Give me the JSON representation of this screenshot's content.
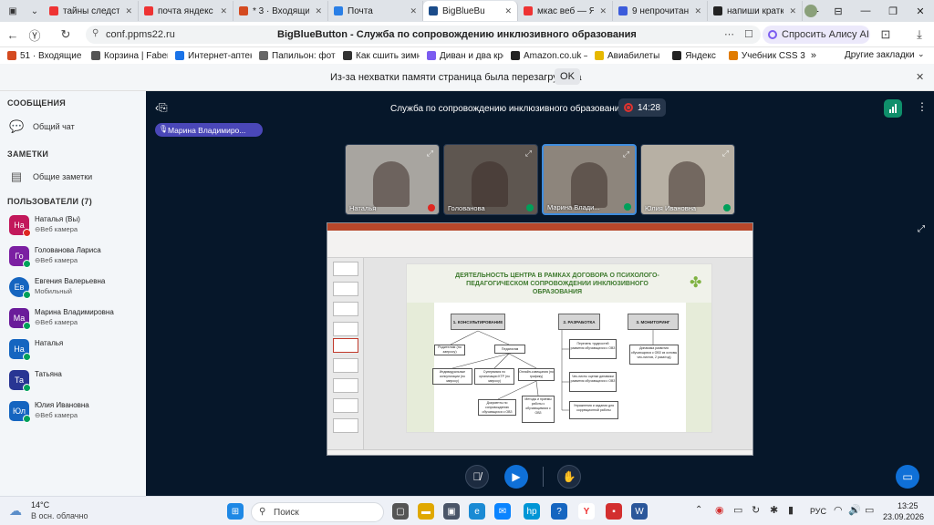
{
  "browser": {
    "tabs": [
      {
        "title": "тайны следстви",
        "color": "#e33"
      },
      {
        "title": "почта яндекс -",
        "color": "#e33"
      },
      {
        "title": "* 3 · Входящие",
        "color": "#d44a20"
      },
      {
        "title": "Почта",
        "color": "#2a7fe6"
      },
      {
        "title": "BigBlueBu",
        "color": "#1b4c8a",
        "active": true
      },
      {
        "title": "мкас веб — Янд",
        "color": "#e33"
      },
      {
        "title": "9 непрочитанн",
        "color": "#3b5bdb"
      },
      {
        "title": "напиши кратко",
        "color": "#222"
      }
    ],
    "url": "conf.ppms22.ru",
    "page_title": "BigBlueButton - Служба по сопровождению инклюзивного образования",
    "alice_label": "Спросить Алису AI",
    "bookmarks": [
      {
        "label": "51 · Входящие — Я",
        "color": "#d44a20"
      },
      {
        "label": "Корзина | Faberlic",
        "color": "#555"
      },
      {
        "label": "Интернет-аптека",
        "color": "#1a73e8"
      },
      {
        "label": "Папильон: фото, о",
        "color": "#666"
      },
      {
        "label": "Как сшить зимни",
        "color": "#333"
      },
      {
        "label": "Диван и два крес",
        "color": "#7b5cf0"
      },
      {
        "label": "Amazon.co.uk – O",
        "color": "#222"
      },
      {
        "label": "Авиабилеты",
        "color": "#e6b800"
      },
      {
        "label": "Яндекс",
        "color": "#222"
      },
      {
        "label": "Учебник CSS 3. C",
        "color": "#e07b00"
      }
    ],
    "other_bookmarks": "Другие закладки",
    "notification": "Из-за нехватки памяти страница была перезагружена",
    "notification_ok": "OK"
  },
  "sidebar": {
    "messages_title": "СООБЩЕНИЯ",
    "public_chat": "Общий чат",
    "notes_title": "ЗАМЕТКИ",
    "shared_notes": "Общие заметки",
    "users_title": "ПОЛЬЗОВАТЕЛИ (7)",
    "users": [
      {
        "initials": "На",
        "name": "Наталья (Вы)",
        "sub": "⊖Веб камера",
        "color": "#c2185b",
        "muted": true
      },
      {
        "initials": "Го",
        "name": "Голованова Лариса",
        "sub": "⊖Веб камера",
        "color": "#7b1fa2",
        "muted": false
      },
      {
        "initials": "Ев",
        "name": "Евгения Валерьевна",
        "sub": "Мобильный",
        "color": "#1565c0",
        "muted": false
      },
      {
        "initials": "Ма",
        "name": "Марина Владимировна",
        "sub": "⊖Веб камера",
        "color": "#6a1b9a",
        "muted": false
      },
      {
        "initials": "На",
        "name": "Наталья",
        "sub": "",
        "color": "#1565c0",
        "muted": false
      },
      {
        "initials": "Та",
        "name": "Татьяна",
        "sub": "",
        "color": "#283593",
        "muted": false
      },
      {
        "initials": "Юл",
        "name": "Юлия Ивановна",
        "sub": "⊖Веб камера",
        "color": "#1565c0",
        "muted": false
      }
    ]
  },
  "meeting": {
    "title": "Служба по сопровождению инклюзивного образования",
    "timer": "14:28",
    "talker": "Марина Владимиро...",
    "cameras": [
      {
        "name": "Наталья",
        "muted": true,
        "bg": "#a8a5a0"
      },
      {
        "name": "Голованова",
        "muted": false,
        "bg": "#5e5650"
      },
      {
        "name": "Марина Влади...",
        "muted": false,
        "bg": "#8d857c"
      },
      {
        "name": "Юлия Ивановна",
        "muted": false,
        "bg": "#b7b0a4"
      }
    ],
    "slide": {
      "heading": "ДЕЯТЕЛЬНОСТЬ ЦЕНТРА В РАМКАХ ДОГОВОРА О ПСИХОЛОГО-ПЕДАГОГИЧЕСКОМ СОПРОВОЖДЕНИИ ИНКЛЮЗИВНОГО ОБРАЗОВАНИЯ",
      "col1": "1. КОНСУЛЬТИРОВАНИЕ",
      "col2": "2. РАЗРАБОТКА",
      "col3": "3. МОНИТОРИНГ",
      "parents": "Родителям (по запросу)",
      "teachers": "Педагогам",
      "individual": "Индивидуальные консультации (по запросу)",
      "supervision": "Супервизия по организации КТР (по запросу)",
      "online": "Онлайн-совещания (по графику)",
      "docs": "Документы по сопровождению обучающихся с ОВЗ",
      "methods": "Методы и приемы работы с обучающимися с ОВЗ",
      "lists": "Перечень трудностей развития обучающихся с ОВЗ",
      "checklists": "Чек-листы оценки динамики развития обучающихся с ОВЗ",
      "exercises": "Упражнения и задания для коррекционной работы",
      "dynamics": "Динамика развития обучающихся с ОВЗ из основы чек-листов, 2 раза/год)"
    }
  },
  "taskbar": {
    "temp": "14°C",
    "weather": "В осн. облачно",
    "search": "Поиск",
    "lang": "РУС",
    "time": "13:25",
    "date": "23.09.2026"
  }
}
